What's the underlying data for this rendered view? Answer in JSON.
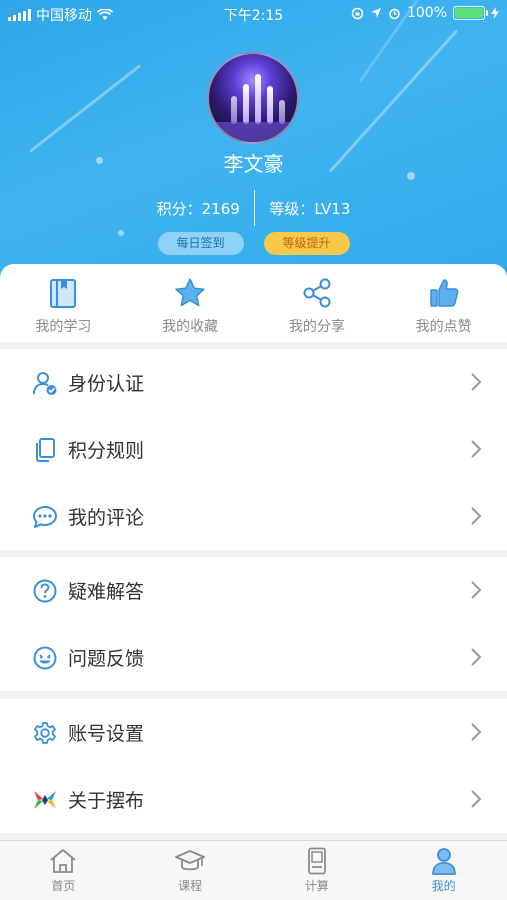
{
  "status_bar": {
    "carrier": "中国移动",
    "time": "下午2:15",
    "battery": "100%"
  },
  "profile": {
    "name": "李文豪",
    "points_label": "积分：2169",
    "level_label": "等级：LV13",
    "daily_checkin": "每日签到",
    "level_up": "等级提升"
  },
  "quick_actions": [
    {
      "label": "我的学习",
      "icon": "book-icon"
    },
    {
      "label": "我的收藏",
      "icon": "star-icon"
    },
    {
      "label": "我的分享",
      "icon": "share-icon"
    },
    {
      "label": "我的点赞",
      "icon": "thumbs-up-icon"
    }
  ],
  "menu_groups": [
    [
      {
        "label": "身份认证",
        "icon": "user-verify-icon"
      },
      {
        "label": "积分规则",
        "icon": "copy-icon"
      },
      {
        "label": "我的评论",
        "icon": "chat-bubble-icon"
      }
    ],
    [
      {
        "label": "疑难解答",
        "icon": "question-icon"
      },
      {
        "label": "问题反馈",
        "icon": "smiley-icon"
      }
    ],
    [
      {
        "label": "账号设置",
        "icon": "gear-icon"
      },
      {
        "label": "关于摆布",
        "icon": "app-logo-icon"
      }
    ]
  ],
  "tabs": [
    {
      "label": "首页",
      "icon": "home-icon",
      "active": false
    },
    {
      "label": "课程",
      "icon": "graduation-cap-icon",
      "active": false
    },
    {
      "label": "计算",
      "icon": "calculator-icon",
      "active": false
    },
    {
      "label": "我的",
      "icon": "person-icon",
      "active": true
    }
  ],
  "colors": {
    "accent": "#3b8fd9",
    "header": "#3fb4f0",
    "level_pill": "#f7c94a",
    "sign_pill": "#8ed2f6"
  }
}
